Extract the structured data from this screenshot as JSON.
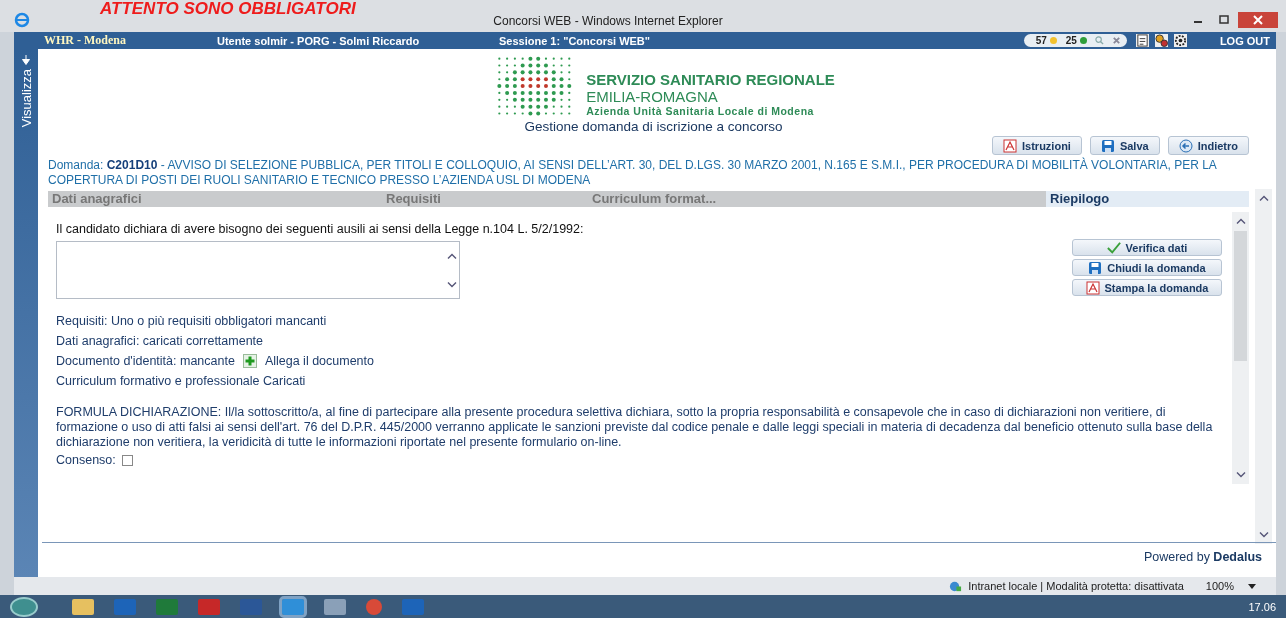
{
  "overlay_note": "ATTENTO SONO OBBLIGATORI",
  "window": {
    "title": "Concorsi WEB - Windows Internet Explorer"
  },
  "app_bar": {
    "site": "WHR - Modena",
    "user": "Utente solmir - PORG - Solmi Riccardo",
    "session": "Sessione 1: \"Concorsi WEB\"",
    "counters": [
      {
        "value": "57",
        "color": "#f2c12e"
      },
      {
        "value": "25",
        "color": "#2f9e3a"
      }
    ],
    "logout": "LOG OUT"
  },
  "side_tab": "Visualizza",
  "header": {
    "org_title": "SERVIZIO SANITARIO REGIONALE",
    "region": "EMILIA-ROMAGNA",
    "agency": "Azienda Unità Sanitaria Locale di Modena",
    "subtitle": "Gestione domanda di iscrizione a concorso"
  },
  "toolbar": [
    {
      "label": "Istruzioni",
      "kind": "pdf"
    },
    {
      "label": "Salva",
      "kind": "save"
    },
    {
      "label": "Indietro",
      "kind": "back"
    }
  ],
  "domanda": "Domanda: **C201D10** - AVVISO DI SELEZIONE PUBBLICA, PER TITOLI E COLLOQUIO, AI SENSI DELL’ART. 30, DEL D.LGS. 30 MARZO 2001, N.165 E S.M.I., PER PROCEDURA DI MOBILITÀ VOLONTARIA, PER LA COPERTURA DI POSTI DEI RUOLI SANITARIO E TECNICO PRESSO L’AZIENDA USL DI MODENA",
  "tabs": [
    {
      "label": "Dati anagrafici",
      "selected": false
    },
    {
      "label": "Requisiti",
      "selected": false
    },
    {
      "label": "Curriculum format...",
      "selected": false
    },
    {
      "label": "Riepilogo",
      "selected": true
    }
  ],
  "ausili_label": "Il candidato dichiara di avere bisogno dei seguenti ausili ai sensi della Legge n.104 L. 5/2/1992:",
  "actions": [
    {
      "label": "Verifica dati",
      "kind": "verify"
    },
    {
      "label": "Chiudi la domanda",
      "kind": "save"
    },
    {
      "label": "Stampa la domanda",
      "kind": "pdf"
    }
  ],
  "status_lines": [
    {
      "text": "Requisiti: Uno o più requisiti obbligatori mancanti"
    },
    {
      "text": "Dati anagrafici: caricati correttamente"
    },
    {
      "text": "Documento d'identità: mancante",
      "link": "Allega il documento"
    },
    {
      "text": "Curriculum formativo e professionale Caricati"
    }
  ],
  "formula": "FORMULA DICHIARAZIONE: Il/la sottoscritto/a, al fine di partecipare alla presente procedura selettiva dichiara, sotto la propria responsabilità e consapevole che in caso di dichiarazioni non veritiere, di formazione o uso di atti falsi ai sensi dell'art. 76 del D.P.R. 445/2000 verranno applicate le sanzioni previste dal codice penale e dalle leggi speciali in materia di decadenza dal beneficio ottenuto sulla base della dichiarazione non veritiera, la veridicità di tutte le informazioni riportate nel presente formulario on-line.",
  "consent": {
    "label": "Consenso:",
    "checked": false
  },
  "footer": "Powered by **Dedalus**",
  "status_bar": {
    "zone": "Intranet locale | Modalità protetta: disattivata",
    "zoom": "100%"
  },
  "taskbar": {
    "clock": "17.06"
  }
}
